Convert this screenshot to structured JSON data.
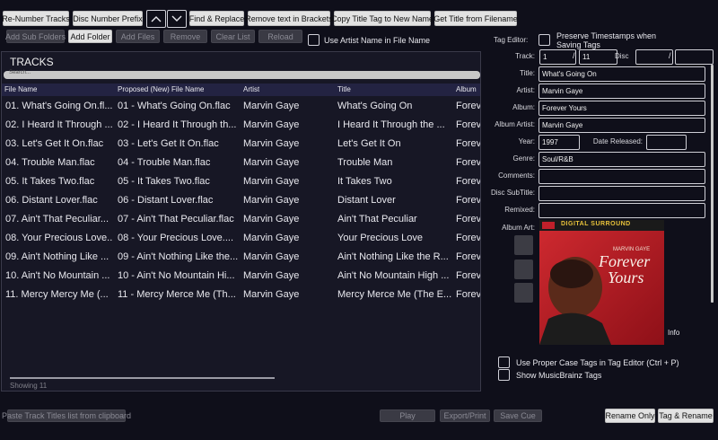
{
  "toolbar": {
    "renumber": "Re-Number Tracks",
    "disc_prefix": "Disc Number Prefix",
    "find_replace": "Find & Replace",
    "remove_brackets": "Remove text in Brackets",
    "copy_title": "Copy Title Tag to New Name",
    "title_from_filename": "Get Title from Filename"
  },
  "toolbar2": {
    "add_subfolders": "Add Sub Folders",
    "add_folder": "Add Folder",
    "add_files": "Add Files",
    "remove": "Remove",
    "clear_list": "Clear List",
    "reload": "Reload",
    "use_artist": "Use Artist Name in File Name"
  },
  "tracks": {
    "title": "TRACKS",
    "search_placeholder": "Search...",
    "columns": [
      "File Name",
      "Proposed (New) File Name",
      "Artist",
      "Title",
      "Album"
    ],
    "rows": [
      [
        "01. What's Going On.fl...",
        "01 - What's Going On.flac",
        "Marvin Gaye",
        "What's Going On",
        "Forev"
      ],
      [
        "02. I Heard It Through ...",
        "02 - I Heard It Through th...",
        "Marvin Gaye",
        "I Heard It Through the ...",
        "Forev"
      ],
      [
        "03. Let's Get It On.flac",
        "03 - Let's Get It On.flac",
        "Marvin Gaye",
        "Let's Get It On",
        "Forev"
      ],
      [
        "04. Trouble Man.flac",
        "04 - Trouble Man.flac",
        "Marvin Gaye",
        "Trouble Man",
        "Forev"
      ],
      [
        "05. It Takes Two.flac",
        "05 - It Takes Two.flac",
        "Marvin Gaye",
        "It Takes Two",
        "Forev"
      ],
      [
        "06. Distant Lover.flac",
        "06 - Distant Lover.flac",
        "Marvin Gaye",
        "Distant Lover",
        "Forev"
      ],
      [
        "07. Ain't That Peculiar...",
        "07 - Ain't That Peculiar.flac",
        "Marvin Gaye",
        "Ain't That Peculiar",
        "Forev"
      ],
      [
        "08. Your Precious Love...",
        "08 - Your Precious Love....",
        "Marvin Gaye",
        "Your Precious Love",
        "Forev"
      ],
      [
        "09. Ain't Nothing Like ...",
        "09 - Ain't Nothing Like the...",
        "Marvin Gaye",
        "Ain't Nothing Like the R...",
        "Forev"
      ],
      [
        "10. Ain't No Mountain ...",
        "10 - Ain't No Mountain Hi...",
        "Marvin Gaye",
        "Ain't No Mountain High ...",
        "Forev"
      ],
      [
        "11. Mercy Mercy Me (...",
        "11 - Mercy Merce Me (Th...",
        "Marvin Gaye",
        "Mercy Merce Me (The E...",
        "Forev"
      ]
    ],
    "status": "Showing 11"
  },
  "editor": {
    "label": "Tag Editor:",
    "preserve": "Preserve Timestamps when Saving Tags",
    "track_label": "Track:",
    "track": "1",
    "of": "11",
    "disc_label": "Disc",
    "disc": "",
    "disc_of": "",
    "title_label": "Title:",
    "title": "What's Going On",
    "artist_label": "Artist:",
    "artist": "Marvin Gaye",
    "album_label": "Album:",
    "album": "Forever Yours",
    "album_artist_label": "Album Artist:",
    "album_artist": "Marvin Gaye",
    "year_label": "Year:",
    "year": "1997",
    "date_label": "Date Released:",
    "date": "",
    "genre_label": "Genre:",
    "genre": "Soul/R&B",
    "comments_label": "Comments:",
    "comments": "",
    "subtitle_label": "Disc SubTitle:",
    "subtitle": "",
    "remixed_label": "Remixed:",
    "remixed": "",
    "art_label": "Album Art:",
    "info": "Info",
    "cover": {
      "top_banner": "DIGITAL SURROUND",
      "artist": "MARVIN GAYE",
      "title_line1": "Forever",
      "title_line2": "Yours"
    },
    "proper_case": "Use Proper Case Tags in Tag Editor (Ctrl + P)",
    "musicbrainz": "Show MusicBrainz Tags"
  },
  "bottom": {
    "paste": "Paste Track Titles list from clipboard",
    "play": "Play",
    "export": "Export/Print",
    "save_cue": "Save Cue",
    "rename_only": "Rename Only",
    "tag_rename": "Tag & Rename"
  },
  "colors": {
    "background": "#0f0f1a",
    "panel": "#171725",
    "header_row": "#232342",
    "accent_red": "#c0202a"
  }
}
